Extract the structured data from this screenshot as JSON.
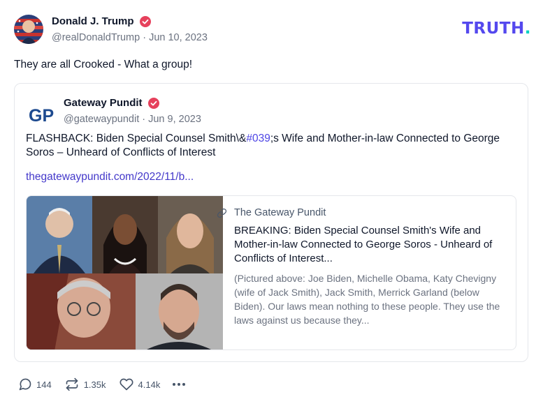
{
  "post": {
    "author_name": "Donald J. Trump",
    "author_meta": "@realDonaldTrump · Jun 10, 2023",
    "text": "They are all Crooked - What a group!"
  },
  "brand": {
    "logo_main": "TRUTH",
    "logo_dot": ".",
    "primary_color": "#5448ee",
    "accent_color": "#00d1c1"
  },
  "quoted": {
    "avatar_text": "GP",
    "author_name": "Gateway Pundit",
    "author_meta": "@gatewaypundit · Jun 9, 2023",
    "text_before": "FLASHBACK: Biden Special Counsel Smith\\&",
    "hashtag": "#039",
    "text_after": ";s Wife and Mother-in-law Connected to George Soros – Unheard of Conflicts of Interest",
    "link": "thegatewaypundit.com/2022/11/b..."
  },
  "card": {
    "site": "The Gateway Pundit",
    "title": "BREAKING: Biden Special Counsel Smith's Wife and Mother-in-law Connected to George Soros - Unheard of Conflicts of Interest...",
    "description": "(Pictured above: Joe Biden, Michelle Obama, Katy Chevigny (wife of Jack Smith), Jack Smith, Merrick Garland (below Biden). Our laws mean nothing to these people. They use the laws against us because they..."
  },
  "actions": {
    "replies": "144",
    "retruths": "1.35k",
    "likes": "4.14k"
  },
  "icons": [
    "verified-badge-icon",
    "link-icon",
    "reply-icon",
    "retruth-icon",
    "like-icon",
    "more-icon"
  ]
}
